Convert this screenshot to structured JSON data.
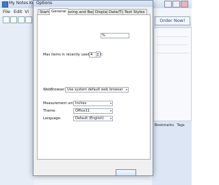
{
  "background_app": {
    "title": "My Notes Kee",
    "menus": [
      "File",
      "Edit",
      "Vi"
    ],
    "order_now": "Order Now!",
    "bottom_tabs": [
      "Bookmarks",
      "Tags"
    ]
  },
  "dialog": {
    "title": "Options",
    "tabs": [
      "Startup",
      "General",
      "Saving and Backup",
      "Display",
      "Date/Time",
      "Text Styles"
    ],
    "active_tab": "General",
    "fields": {
      "max_recent_label": "Max items in recently used file list:",
      "max_recent_value": "4",
      "percent_suffix": "%",
      "web_browser_label": "WebBrowser:",
      "web_browser_value": "Use system default web browser",
      "measurement_label": "Measurement units:",
      "measurement_value": "Inches",
      "theme_label": "Theme:",
      "theme_value": "Office11",
      "language_label": "Language:",
      "language_value": "Default (English)"
    }
  },
  "colors": {
    "dialog_bg": "#f0f0f0",
    "panel_bg": "#ffffff",
    "accent": "#3f7ac4"
  }
}
